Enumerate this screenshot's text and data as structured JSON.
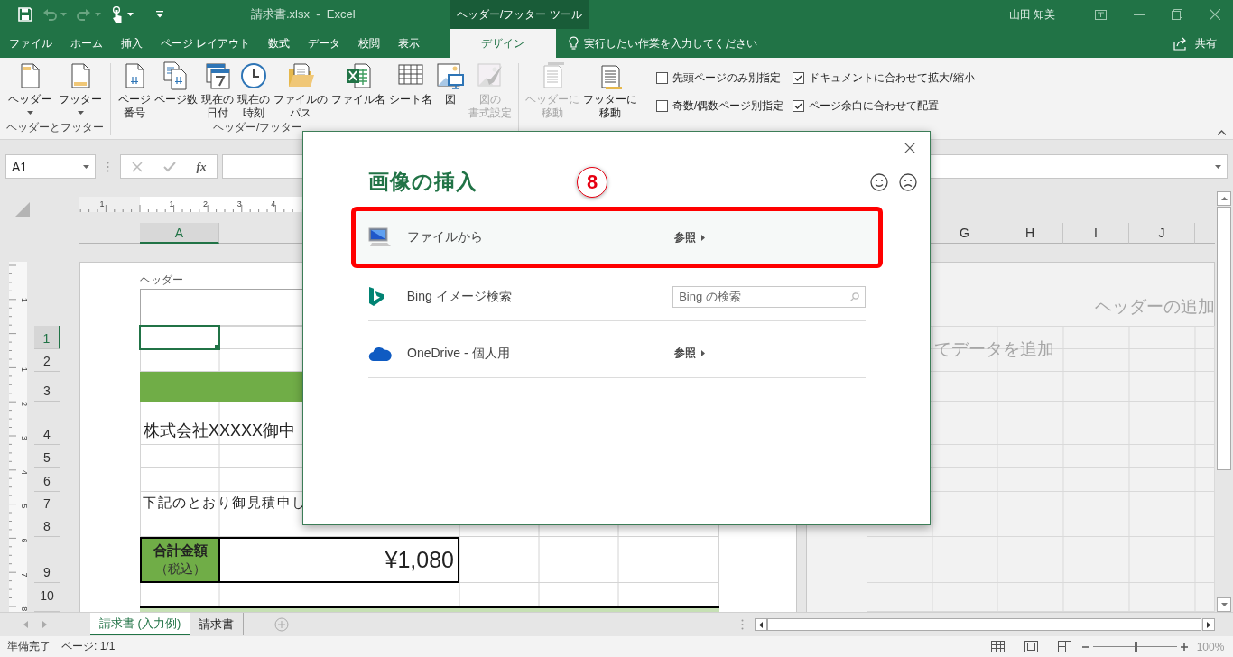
{
  "title_bar": {
    "quick_access": [
      {
        "kind": "save",
        "disabled": false,
        "dropdown": false
      },
      {
        "kind": "undo",
        "disabled": true,
        "dropdown": true
      },
      {
        "kind": "redo",
        "disabled": true,
        "dropdown": true
      },
      {
        "kind": "touch",
        "disabled": false,
        "dropdown": true
      },
      {
        "kind": "customize",
        "disabled": false,
        "dropdown": false
      }
    ],
    "document_title": "請求書.xlsx  -  Excel",
    "context_tab": "ヘッダー/フッター ツール",
    "user": "山田 知美"
  },
  "ribbon_tabs": [
    {
      "label": "ファイル",
      "selected": false
    },
    {
      "label": "ホーム",
      "selected": false
    },
    {
      "label": "挿入",
      "selected": false
    },
    {
      "label": "ページ レイアウト",
      "selected": false
    },
    {
      "label": "数式",
      "selected": false
    },
    {
      "label": "データ",
      "selected": false
    },
    {
      "label": "校閲",
      "selected": false
    },
    {
      "label": "表示",
      "selected": false
    },
    {
      "label": "デザイン",
      "selected": true
    }
  ],
  "tell_me": {
    "placeholder": "実行したい作業を入力してください"
  },
  "share": "共有",
  "ribbon": {
    "groups": [
      {
        "label": "ヘッダーとフッター",
        "buttons": [
          {
            "kind": "header",
            "lines": [
              "ヘッダー"
            ],
            "dropdown": true,
            "disabled": false
          },
          {
            "kind": "footer",
            "lines": [
              "フッター"
            ],
            "dropdown": true,
            "disabled": false
          }
        ]
      },
      {
        "label": "ヘッダー/フッター",
        "buttons": [
          {
            "kind": "page-number",
            "lines": [
              "ページ",
              "番号"
            ],
            "dropdown": false,
            "disabled": false
          },
          {
            "kind": "page-count",
            "lines": [
              "ページ数"
            ],
            "dropdown": false,
            "disabled": false
          },
          {
            "kind": "date",
            "lines": [
              "現在の",
              "日付"
            ],
            "dropdown": false,
            "disabled": false
          },
          {
            "kind": "time",
            "lines": [
              "現在の",
              "時刻"
            ],
            "dropdown": false,
            "disabled": false
          },
          {
            "kind": "file-path",
            "lines": [
              "ファイルの",
              "パス"
            ],
            "dropdown": false,
            "disabled": false
          },
          {
            "kind": "file-name",
            "lines": [
              "ファイル名"
            ],
            "dropdown": false,
            "disabled": false
          },
          {
            "kind": "sheet-name",
            "lines": [
              "シート名"
            ],
            "dropdown": false,
            "disabled": false
          },
          {
            "kind": "picture",
            "lines": [
              "図"
            ],
            "dropdown": false,
            "disabled": false
          },
          {
            "kind": "format-picture",
            "lines": [
              "図の",
              "書式設定"
            ],
            "dropdown": false,
            "disabled": true
          }
        ]
      },
      {
        "buttons": [
          {
            "kind": "goto-header",
            "lines": [
              "ヘッダーに",
              "移動"
            ],
            "dropdown": false,
            "disabled": true
          },
          {
            "kind": "goto-footer",
            "lines": [
              "フッターに",
              "移動"
            ],
            "dropdown": false,
            "disabled": false
          }
        ]
      },
      {
        "checkboxes": [
          {
            "label": "先頭ページのみ別指定",
            "checked": false
          },
          {
            "label": "奇数/偶数ページ別指定",
            "checked": false
          },
          {
            "label": "ドキュメントに合わせて拡大/縮小",
            "checked": true
          },
          {
            "label": "ページ余白に合わせて配置",
            "checked": true
          }
        ]
      }
    ]
  },
  "formula_bar": {
    "name_box": "A1",
    "function_label": "fx"
  },
  "sheet": {
    "ruler_labels": [
      "1",
      "1",
      "2",
      "3",
      "4"
    ],
    "vertical_ruler_labels": [
      "1",
      "1",
      "2",
      "3",
      "4",
      "5",
      "6",
      "7",
      "8"
    ],
    "columns": [
      {
        "label": "A",
        "selected": true
      },
      {
        "label": "G",
        "selected": false
      },
      {
        "label": "H",
        "selected": false
      },
      {
        "label": "I",
        "selected": false
      },
      {
        "label": "J",
        "selected": false
      }
    ],
    "header_label": "ヘッダー",
    "rows": [
      {
        "number": "1",
        "selected": true
      },
      {
        "number": "2",
        "selected": false
      },
      {
        "number": "3",
        "selected": false,
        "kind": "band"
      },
      {
        "number": "4",
        "selected": false,
        "kind": "title",
        "text": "株式会社XXXXX御中"
      },
      {
        "number": "5",
        "selected": false
      },
      {
        "number": "6",
        "selected": false
      },
      {
        "number": "7",
        "selected": false,
        "kind": "text",
        "text": "下記のとおり御見積申し"
      },
      {
        "number": "8",
        "selected": false
      },
      {
        "number": "9",
        "selected": false,
        "kind": "total",
        "label": "合計金額",
        "note": "（税込）",
        "value": "¥1,080"
      },
      {
        "number": "10",
        "selected": false
      }
    ],
    "right_page": {
      "header_placeholder": "ヘッダーの追加",
      "body_placeholder": "てデータを追加"
    }
  },
  "dialog": {
    "title": "画像の挿入",
    "step_badge": "8",
    "options": [
      {
        "kind": "computer",
        "label": "ファイルから",
        "action": "参照",
        "highlighted": true
      },
      {
        "kind": "web-search",
        "label": "Bing イメージ検索",
        "placeholder": "Bing の検索",
        "highlighted": false
      },
      {
        "kind": "cloud",
        "label": "OneDrive - 個人用",
        "action": "参照",
        "highlighted": false
      }
    ]
  },
  "sheet_tabs": [
    {
      "label": "請求書 (入力例)",
      "selected": true
    },
    {
      "label": "請求書",
      "selected": false
    }
  ],
  "status_bar": {
    "mode": "準備完了",
    "page": "ページ: 1/1",
    "zoom": {
      "level": 0.5,
      "reading": "100%"
    }
  }
}
